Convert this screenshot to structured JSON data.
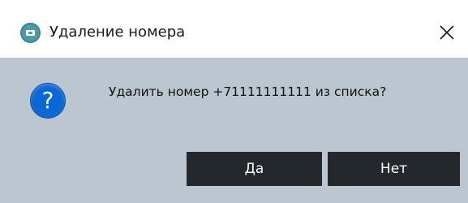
{
  "dialog": {
    "title": "Удаление номера",
    "app_icon": "phone-book-icon",
    "close_icon": "close-icon",
    "question_icon": "question-icon",
    "question_glyph": "?",
    "message": "Удалить номер +71111111111 из списка?",
    "buttons": {
      "yes_label": "Да",
      "no_label": "Нет"
    }
  },
  "colors": {
    "titlebar_bg": "#ffffff",
    "body_bg": "#bcc6d0",
    "button_bg": "#22282c",
    "button_text": "#ffffff",
    "question_icon_bg": "#0c67d6"
  }
}
